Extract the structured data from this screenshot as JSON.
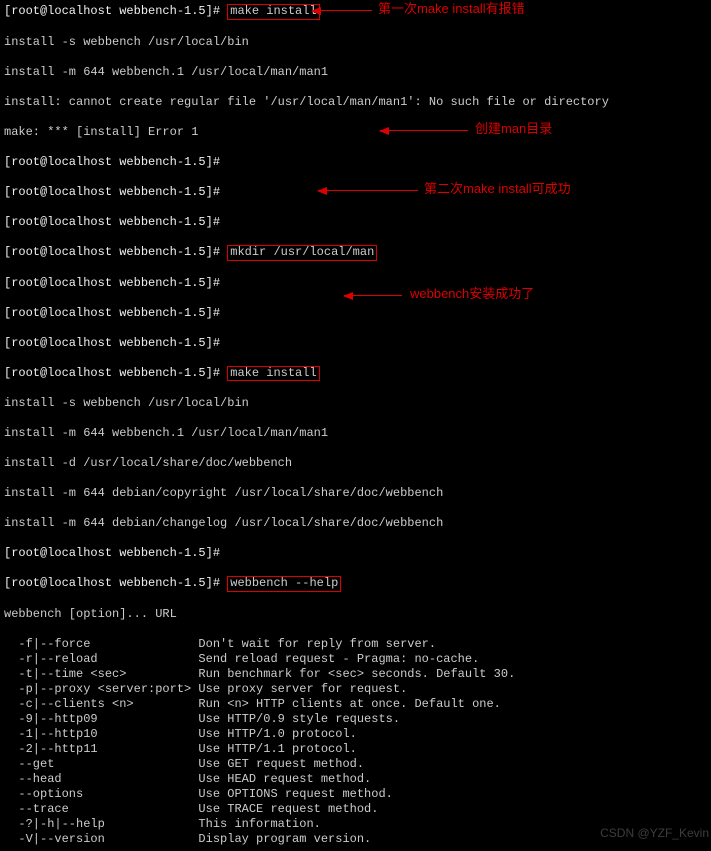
{
  "prompt": "[root@localhost webbench-1.5]#",
  "cmds": {
    "make_install": "make install",
    "mkdir": "mkdir /usr/local/man",
    "help": "webbench --help"
  },
  "out1": {
    "l1": "install -s webbench /usr/local/bin",
    "l2": "install -m 644 webbench.1 /usr/local/man/man1",
    "l3": "install: cannot create regular file '/usr/local/man/man1': No such file or directory",
    "l4": "make: *** [install] Error 1"
  },
  "out2": {
    "l1": "install -s webbench /usr/local/bin",
    "l2": "install -m 644 webbench.1 /usr/local/man/man1",
    "l3": "install -d /usr/local/share/doc/webbench",
    "l4": "install -m 644 debian/copyright /usr/local/share/doc/webbench",
    "l5": "install -m 644 debian/changelog /usr/local/share/doc/webbench"
  },
  "help": {
    "head": "webbench [option]... URL",
    "rows": [
      {
        "opt": "  -f|--force               ",
        "desc": "Don't wait for reply from server."
      },
      {
        "opt": "  -r|--reload              ",
        "desc": "Send reload request - Pragma: no-cache."
      },
      {
        "opt": "  -t|--time <sec>          ",
        "desc": "Run benchmark for <sec> seconds. Default 30."
      },
      {
        "opt": "  -p|--proxy <server:port> ",
        "desc": "Use proxy server for request."
      },
      {
        "opt": "  -c|--clients <n>         ",
        "desc": "Run <n> HTTP clients at once. Default one."
      },
      {
        "opt": "  -9|--http09              ",
        "desc": "Use HTTP/0.9 style requests."
      },
      {
        "opt": "  -1|--http10              ",
        "desc": "Use HTTP/1.0 protocol."
      },
      {
        "opt": "  -2|--http11              ",
        "desc": "Use HTTP/1.1 protocol."
      },
      {
        "opt": "  --get                    ",
        "desc": "Use GET request method."
      },
      {
        "opt": "  --head                   ",
        "desc": "Use HEAD request method."
      },
      {
        "opt": "  --options                ",
        "desc": "Use OPTIONS request method."
      },
      {
        "opt": "  --trace                  ",
        "desc": "Use TRACE request method."
      },
      {
        "opt": "  -?|-h|--help             ",
        "desc": "This information."
      },
      {
        "opt": "  -V|--version             ",
        "desc": "Display program version."
      }
    ]
  },
  "anno": {
    "a1": "第一次make install有报错",
    "a2": "创建man目录",
    "a3": "第二次make install可成功",
    "a4": "webbench安装成功了"
  },
  "watermark": "CSDN @YZF_Kevin"
}
